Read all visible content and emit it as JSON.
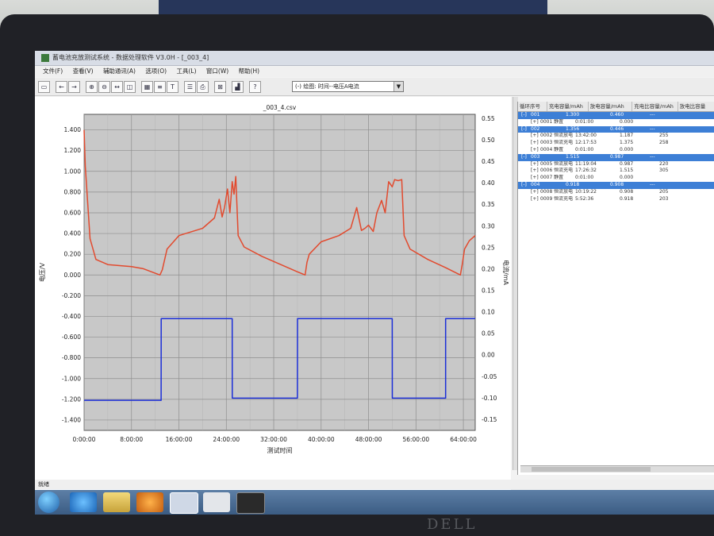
{
  "window": {
    "title": "蓄电池充放测试系统 - 数据处理软件 V3.0H - [_003_4]",
    "menu": [
      "文件(F)",
      "查看(V)",
      "辅助通讯(A)",
      "选项(O)",
      "工具(L)",
      "窗口(W)",
      "帮助(H)"
    ]
  },
  "toolbar": {
    "view_select": "(-) 绘图: 时间--电压A电流",
    "icons": [
      "open-icon",
      "back-icon",
      "forward-icon",
      "zoom-in-icon",
      "zoom-out-icon",
      "zoom-fit-icon",
      "zoom-area-icon",
      "table-icon",
      "list-icon",
      "text-icon",
      "stats-icon",
      "print-icon",
      "export-icon",
      "chart-icon",
      "help-icon"
    ]
  },
  "chart_data": {
    "type": "line",
    "title": "_003_4.csv",
    "xlabel": "测试时间",
    "ylabel": "电压/V",
    "y2label": "电流/mA",
    "xlim": [
      0,
      66
    ],
    "ylim": [
      -1.5,
      1.55
    ],
    "y2lim": [
      -0.175,
      0.56
    ],
    "x_ticks": [
      "0:00:00",
      "8:00:00",
      "16:00:00",
      "24:00:00",
      "32:00:00",
      "40:00:00",
      "48:00:00",
      "56:00:00",
      "64:00:00"
    ],
    "y_ticks": [
      "1.400",
      "1.200",
      "1.000",
      "0.800",
      "0.600",
      "0.400",
      "0.200",
      "0.000",
      "-0.200",
      "-0.400",
      "-0.600",
      "-0.800",
      "-1.000",
      "-1.200",
      "-1.400"
    ],
    "y2_ticks": [
      "0.55",
      "0.50",
      "0.45",
      "0.40",
      "0.35",
      "0.30",
      "0.25",
      "0.20",
      "0.15",
      "0.10",
      "0.05",
      "0.00",
      "-0.05",
      "-0.10",
      "-0.15"
    ],
    "series": [
      {
        "color": "#e24a2e",
        "axis": "left",
        "x": [
          0,
          0.2,
          0.6,
          1,
          2,
          4,
          8,
          10,
          12.8,
          13.2,
          14,
          16,
          20,
          22,
          22.8,
          23.3,
          23.7,
          24.2,
          24.6,
          25,
          25.3,
          25.6,
          26,
          27,
          30,
          34,
          36,
          37.3,
          37.6,
          38,
          40,
          43,
          45,
          46,
          46.8,
          47.4,
          48,
          48.8,
          49.4,
          50.2,
          50.8,
          51.4,
          52,
          52.4,
          53,
          53.6,
          54,
          55,
          58,
          61,
          63.5,
          63.8,
          64.2,
          65,
          66
        ],
        "y": [
          1.4,
          1.05,
          0.7,
          0.35,
          0.15,
          0.1,
          0.08,
          0.06,
          0.0,
          0.05,
          0.25,
          0.38,
          0.45,
          0.55,
          0.73,
          0.56,
          0.65,
          0.83,
          0.6,
          0.9,
          0.78,
          0.95,
          0.38,
          0.27,
          0.18,
          0.08,
          0.03,
          0.0,
          0.12,
          0.2,
          0.32,
          0.38,
          0.45,
          0.65,
          0.43,
          0.45,
          0.48,
          0.42,
          0.6,
          0.72,
          0.6,
          0.9,
          0.85,
          0.92,
          0.91,
          0.92,
          0.38,
          0.25,
          0.15,
          0.07,
          0.0,
          0.1,
          0.25,
          0.33,
          0.38
        ]
      },
      {
        "color": "#1c2fd8",
        "axis": "right",
        "x": [
          0,
          13,
          13.01,
          25,
          25.01,
          36,
          36.01,
          52,
          52.01,
          61,
          61.01,
          66
        ],
        "y": [
          -0.105,
          -0.105,
          0.085,
          0.085,
          -0.1,
          -0.1,
          0.085,
          0.085,
          -0.1,
          -0.1,
          0.085,
          0.085
        ]
      }
    ]
  },
  "right_table": {
    "headers": [
      "循环序号",
      "充电容量/mAh",
      "放电容量/mAh",
      "充电比容量/mAh",
      "放电比容量"
    ],
    "rows": [
      {
        "type": "group",
        "cells": [
          "[-]",
          "001",
          "1.300",
          "0.460",
          "---"
        ]
      },
      {
        "type": "step",
        "cells": [
          "[+]",
          "0001 静置",
          "0:01:00",
          "0.000",
          ""
        ]
      },
      {
        "type": "group",
        "cells": [
          "[-]",
          "002",
          "1.356",
          "0.446",
          "---"
        ]
      },
      {
        "type": "step",
        "cells": [
          "[+]",
          "0002 恒流放电",
          "13:42:00",
          "1.187",
          "255"
        ]
      },
      {
        "type": "step",
        "cells": [
          "[+]",
          "0003 恒流充电",
          "12:17:53",
          "1.375",
          "258"
        ]
      },
      {
        "type": "step",
        "cells": [
          "[+]",
          "0004 静置",
          "0:01:00",
          "0.000",
          ""
        ]
      },
      {
        "type": "group",
        "cells": [
          "[-]",
          "003",
          "1.515",
          "0.987",
          "---"
        ]
      },
      {
        "type": "step",
        "cells": [
          "[+]",
          "0005 恒流放电",
          "11:19:04",
          "0.987",
          "220"
        ]
      },
      {
        "type": "step",
        "cells": [
          "[+]",
          "0006 恒流充电",
          "17:26:32",
          "1.515",
          "305"
        ]
      },
      {
        "type": "step",
        "cells": [
          "[+]",
          "0007 静置",
          "0:01:00",
          "0.000",
          ""
        ]
      },
      {
        "type": "group",
        "cells": [
          "[-]",
          "004",
          "0.918",
          "0.908",
          "---"
        ]
      },
      {
        "type": "step",
        "cells": [
          "[+]",
          "0008 恒流放电",
          "10:19:22",
          "0.908",
          "205"
        ]
      },
      {
        "type": "step",
        "cells": [
          "[+]",
          "0009 恒流充电",
          "5:52:36",
          "0.918",
          "203"
        ]
      }
    ]
  },
  "status": {
    "text": "就绪"
  },
  "taskbar": {
    "items": [
      "start-orb",
      "ie-icon",
      "folder-icon",
      "media-player-icon",
      "battery-app-icon",
      "document-icon",
      "monitor-app-icon"
    ]
  },
  "monitor": {
    "brand": "DELL"
  }
}
